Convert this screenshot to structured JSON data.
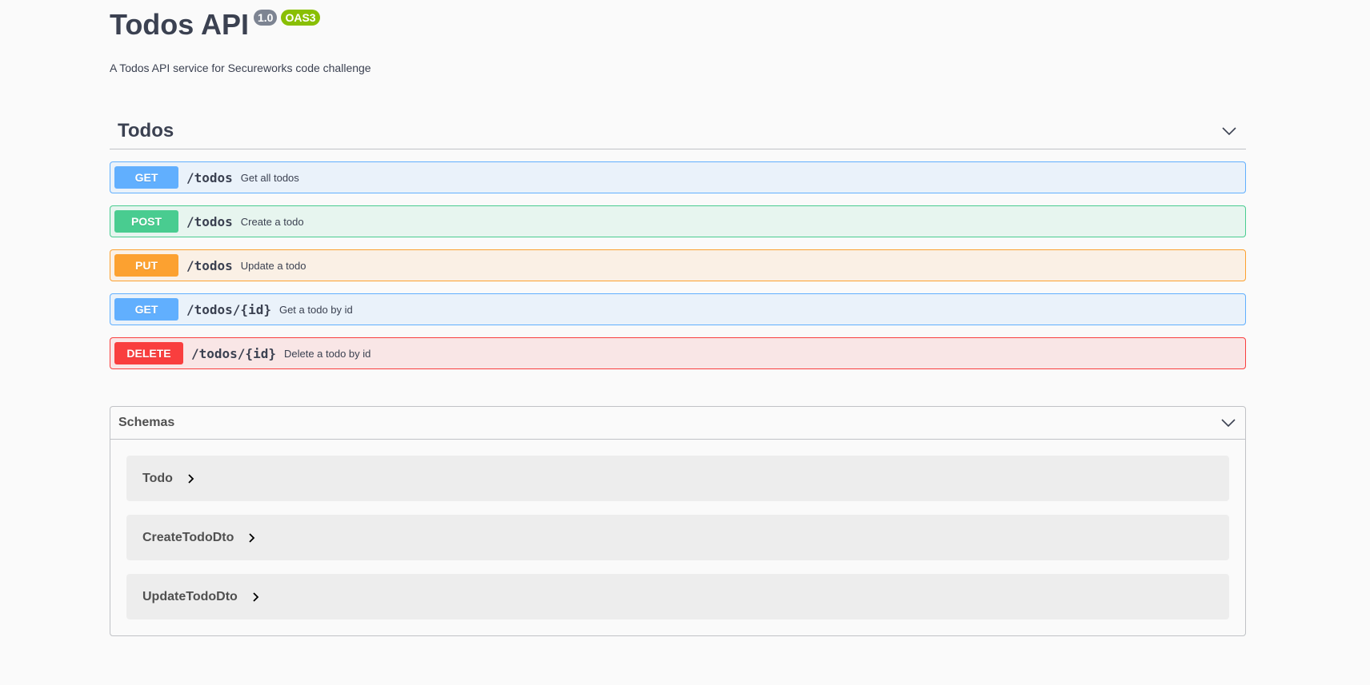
{
  "info": {
    "title": "Todos API",
    "version": "1.0",
    "oas": "OAS3",
    "description": "A Todos API service for Secureworks code challenge"
  },
  "tag": {
    "name": "Todos",
    "icon": "chevron-down-icon"
  },
  "operations": [
    {
      "method": "GET",
      "path": "/todos",
      "summary": "Get all todos"
    },
    {
      "method": "POST",
      "path": "/todos",
      "summary": "Create a todo"
    },
    {
      "method": "PUT",
      "path": "/todos",
      "summary": "Update a todo"
    },
    {
      "method": "GET",
      "path": "/todos/{id}",
      "summary": "Get a todo by id"
    },
    {
      "method": "DELETE",
      "path": "/todos/{id}",
      "summary": "Delete a todo by id"
    }
  ],
  "schemas": {
    "title": "Schemas",
    "items": [
      {
        "name": "Todo"
      },
      {
        "name": "CreateTodoDto"
      },
      {
        "name": "UpdateTodoDto"
      }
    ]
  },
  "colors": {
    "get": "#61affe",
    "post": "#49cc90",
    "put": "#fca130",
    "delete": "#f93e3e",
    "version_badge": "#7d8492",
    "oas_badge": "#89bf04"
  }
}
